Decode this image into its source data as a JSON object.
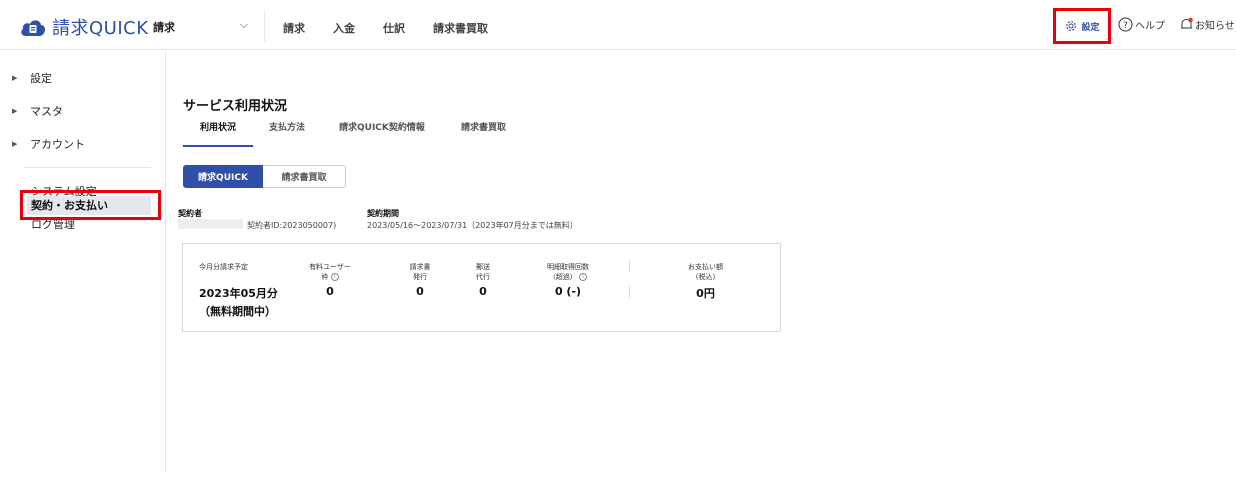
{
  "header": {
    "app_name": "請求QUICK",
    "company_name": "請求",
    "nav": [
      "請求",
      "入金",
      "仕訳",
      "請求書買取"
    ],
    "settings_label": "設定",
    "help_label": "ヘルプ",
    "notice_label": "お知らせ",
    "brand_color": "#2f4fa8",
    "highlight_color": "#e8000b"
  },
  "sidebar": {
    "groups": [
      "設定",
      "マスタ",
      "アカウント"
    ],
    "items": [
      "システム設定",
      "ログ管理",
      "契約・お支払い"
    ]
  },
  "main": {
    "title": "サービス利用状況",
    "tabs": [
      "利用状況",
      "支払方法",
      "請求QUICK契約情報",
      "請求書買取"
    ],
    "segment": [
      "請求QUICK",
      "請求書買取"
    ],
    "contractor_label": "契約者",
    "contractor_id": "契約者ID:2023050007)",
    "period_label": "契約期間",
    "period_value": "2023/05/16〜2023/07/31（2023年07月分までは無料）",
    "summary": {
      "scheduled_label": "今月分請求予定",
      "month": "2023年05月分",
      "free_note": "（無料期間中）",
      "paid_users_label": "有料ユーザー",
      "paid_users_label2": "枠",
      "paid_users": "0",
      "issue_label": "請求書",
      "issue_label2": "発行",
      "issue": "0",
      "mail_label": "郵送",
      "mail_label2": "代行",
      "mail": "0",
      "fetch_label": "明細取得回数",
      "fetch_label2": "（超過）",
      "fetch": "0 (-)",
      "payment_label": "お支払い額",
      "payment_label2": "(税込)",
      "payment": "0円"
    }
  }
}
